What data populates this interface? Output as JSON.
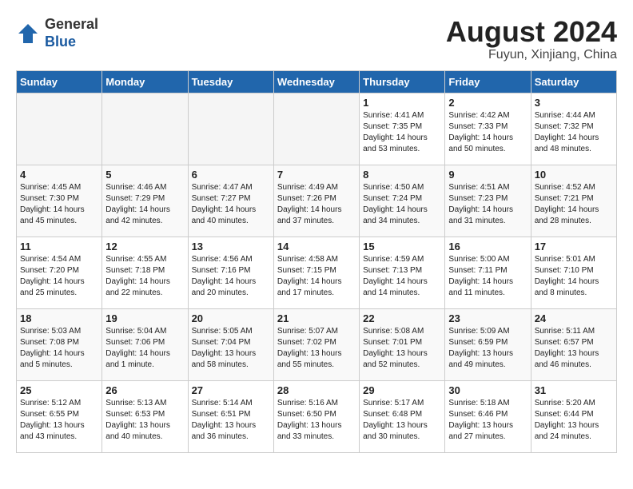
{
  "header": {
    "logo_line1": "General",
    "logo_line2": "Blue",
    "month_year": "August 2024",
    "location": "Fuyun, Xinjiang, China"
  },
  "days_of_week": [
    "Sunday",
    "Monday",
    "Tuesday",
    "Wednesday",
    "Thursday",
    "Friday",
    "Saturday"
  ],
  "weeks": [
    [
      {
        "day": "",
        "info": ""
      },
      {
        "day": "",
        "info": ""
      },
      {
        "day": "",
        "info": ""
      },
      {
        "day": "",
        "info": ""
      },
      {
        "day": "1",
        "info": "Sunrise: 4:41 AM\nSunset: 7:35 PM\nDaylight: 14 hours\nand 53 minutes."
      },
      {
        "day": "2",
        "info": "Sunrise: 4:42 AM\nSunset: 7:33 PM\nDaylight: 14 hours\nand 50 minutes."
      },
      {
        "day": "3",
        "info": "Sunrise: 4:44 AM\nSunset: 7:32 PM\nDaylight: 14 hours\nand 48 minutes."
      }
    ],
    [
      {
        "day": "4",
        "info": "Sunrise: 4:45 AM\nSunset: 7:30 PM\nDaylight: 14 hours\nand 45 minutes."
      },
      {
        "day": "5",
        "info": "Sunrise: 4:46 AM\nSunset: 7:29 PM\nDaylight: 14 hours\nand 42 minutes."
      },
      {
        "day": "6",
        "info": "Sunrise: 4:47 AM\nSunset: 7:27 PM\nDaylight: 14 hours\nand 40 minutes."
      },
      {
        "day": "7",
        "info": "Sunrise: 4:49 AM\nSunset: 7:26 PM\nDaylight: 14 hours\nand 37 minutes."
      },
      {
        "day": "8",
        "info": "Sunrise: 4:50 AM\nSunset: 7:24 PM\nDaylight: 14 hours\nand 34 minutes."
      },
      {
        "day": "9",
        "info": "Sunrise: 4:51 AM\nSunset: 7:23 PM\nDaylight: 14 hours\nand 31 minutes."
      },
      {
        "day": "10",
        "info": "Sunrise: 4:52 AM\nSunset: 7:21 PM\nDaylight: 14 hours\nand 28 minutes."
      }
    ],
    [
      {
        "day": "11",
        "info": "Sunrise: 4:54 AM\nSunset: 7:20 PM\nDaylight: 14 hours\nand 25 minutes."
      },
      {
        "day": "12",
        "info": "Sunrise: 4:55 AM\nSunset: 7:18 PM\nDaylight: 14 hours\nand 22 minutes."
      },
      {
        "day": "13",
        "info": "Sunrise: 4:56 AM\nSunset: 7:16 PM\nDaylight: 14 hours\nand 20 minutes."
      },
      {
        "day": "14",
        "info": "Sunrise: 4:58 AM\nSunset: 7:15 PM\nDaylight: 14 hours\nand 17 minutes."
      },
      {
        "day": "15",
        "info": "Sunrise: 4:59 AM\nSunset: 7:13 PM\nDaylight: 14 hours\nand 14 minutes."
      },
      {
        "day": "16",
        "info": "Sunrise: 5:00 AM\nSunset: 7:11 PM\nDaylight: 14 hours\nand 11 minutes."
      },
      {
        "day": "17",
        "info": "Sunrise: 5:01 AM\nSunset: 7:10 PM\nDaylight: 14 hours\nand 8 minutes."
      }
    ],
    [
      {
        "day": "18",
        "info": "Sunrise: 5:03 AM\nSunset: 7:08 PM\nDaylight: 14 hours\nand 5 minutes."
      },
      {
        "day": "19",
        "info": "Sunrise: 5:04 AM\nSunset: 7:06 PM\nDaylight: 14 hours\nand 1 minute."
      },
      {
        "day": "20",
        "info": "Sunrise: 5:05 AM\nSunset: 7:04 PM\nDaylight: 13 hours\nand 58 minutes."
      },
      {
        "day": "21",
        "info": "Sunrise: 5:07 AM\nSunset: 7:02 PM\nDaylight: 13 hours\nand 55 minutes."
      },
      {
        "day": "22",
        "info": "Sunrise: 5:08 AM\nSunset: 7:01 PM\nDaylight: 13 hours\nand 52 minutes."
      },
      {
        "day": "23",
        "info": "Sunrise: 5:09 AM\nSunset: 6:59 PM\nDaylight: 13 hours\nand 49 minutes."
      },
      {
        "day": "24",
        "info": "Sunrise: 5:11 AM\nSunset: 6:57 PM\nDaylight: 13 hours\nand 46 minutes."
      }
    ],
    [
      {
        "day": "25",
        "info": "Sunrise: 5:12 AM\nSunset: 6:55 PM\nDaylight: 13 hours\nand 43 minutes."
      },
      {
        "day": "26",
        "info": "Sunrise: 5:13 AM\nSunset: 6:53 PM\nDaylight: 13 hours\nand 40 minutes."
      },
      {
        "day": "27",
        "info": "Sunrise: 5:14 AM\nSunset: 6:51 PM\nDaylight: 13 hours\nand 36 minutes."
      },
      {
        "day": "28",
        "info": "Sunrise: 5:16 AM\nSunset: 6:50 PM\nDaylight: 13 hours\nand 33 minutes."
      },
      {
        "day": "29",
        "info": "Sunrise: 5:17 AM\nSunset: 6:48 PM\nDaylight: 13 hours\nand 30 minutes."
      },
      {
        "day": "30",
        "info": "Sunrise: 5:18 AM\nSunset: 6:46 PM\nDaylight: 13 hours\nand 27 minutes."
      },
      {
        "day": "31",
        "info": "Sunrise: 5:20 AM\nSunset: 6:44 PM\nDaylight: 13 hours\nand 24 minutes."
      }
    ]
  ]
}
